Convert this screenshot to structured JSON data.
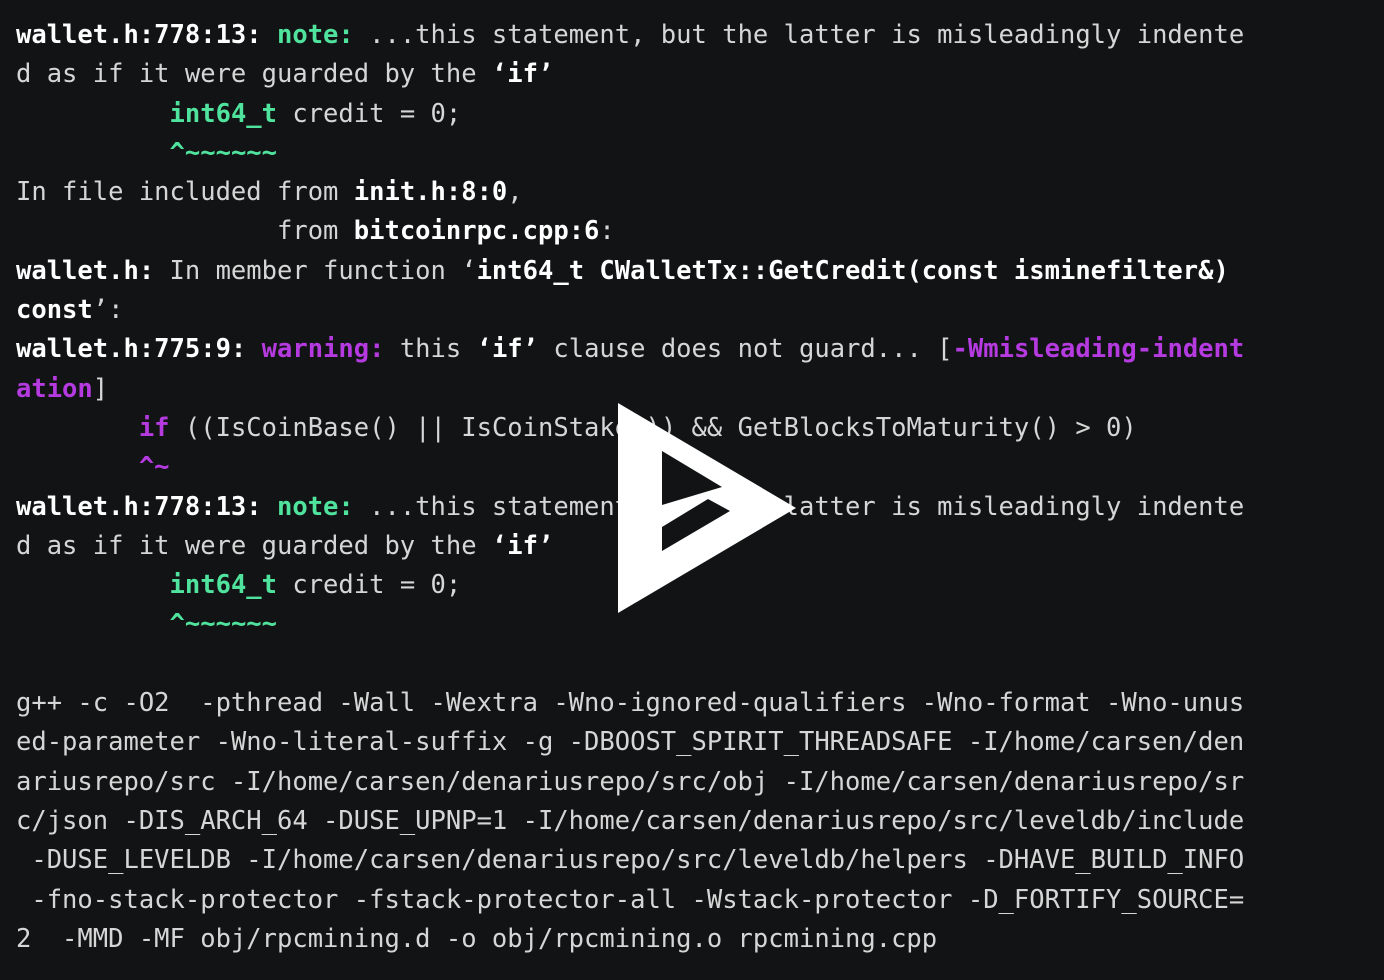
{
  "terminal": {
    "background_color": "#121314",
    "foreground_color": "#d6d6d6",
    "note_color": "#4fe39d",
    "warning_color": "#b53ae0",
    "lines": {
      "l01a": "wallet.h:778:13: ",
      "l01b": "note:",
      "l01c": " ...this statement, but the latter is misleadingly indente",
      "l02": "d as if it were guarded by the ",
      "l02b": "‘if’",
      "l03a": "          ",
      "l03b": "int64_t",
      "l03c": " credit = 0;",
      "l04a": "          ",
      "l04b": "^~~~~~~",
      "l05a": "In file included from ",
      "l05b": "init.h:8:0",
      "l05c": ",",
      "l06a": "                 from ",
      "l06b": "bitcoinrpc.cpp:6",
      "l06c": ":",
      "l07a": "wallet.h:",
      "l07b": " In member function ‘",
      "l07c": "int64_t CWalletTx::GetCredit(const isminefilter&)",
      "l08a": "const",
      "l08b": "’:",
      "l09a": "wallet.h:775:9: ",
      "l09b": "warning:",
      "l09c": " this ",
      "l09d": "‘if’",
      "l09e": " clause does not guard... [",
      "l09f": "-Wmisleading-indent",
      "l10a": "ation",
      "l10b": "]",
      "l11a": "        ",
      "l11b": "if",
      "l11c": " ((IsCoinBase() || IsCoinStake()) && GetBlocksToMaturity() > 0)",
      "l12a": "        ",
      "l12b": "^~",
      "l13a": "wallet.h:778:13: ",
      "l13b": "note:",
      "l13c": " ...this statement, but the latter is misleadingly indente",
      "l14": "d as if it were guarded by the ",
      "l14b": "‘if’",
      "l15a": "          ",
      "l15b": "int64_t",
      "l15c": " credit = 0;",
      "l16a": "          ",
      "l16b": "^~~~~~~",
      "l17": "g++ -c -O2  -pthread -Wall -Wextra -Wno-ignored-qualifiers -Wno-format -Wno-unus",
      "l18": "ed-parameter -Wno-literal-suffix -g -DBOOST_SPIRIT_THREADSAFE -I/home/carsen/den",
      "l19": "ariusrepo/src -I/home/carsen/denariusrepo/src/obj -I/home/carsen/denariusrepo/sr",
      "l20": "c/json -DIS_ARCH_64 -DUSE_UPNP=1 -I/home/carsen/denariusrepo/src/leveldb/include",
      "l21": " -DUSE_LEVELDB -I/home/carsen/denariusrepo/src/leveldb/helpers -DHAVE_BUILD_INFO",
      "l22": " -fno-stack-protector -fstack-protector-all -Wstack-protector -D_FORTIFY_SOURCE=",
      "l23": "2  -MMD -MF obj/rpcmining.d -o obj/rpcmining.o rpcmining.cpp"
    }
  },
  "overlay": {
    "play_button_label": "play-button",
    "color": "#ffffff"
  }
}
